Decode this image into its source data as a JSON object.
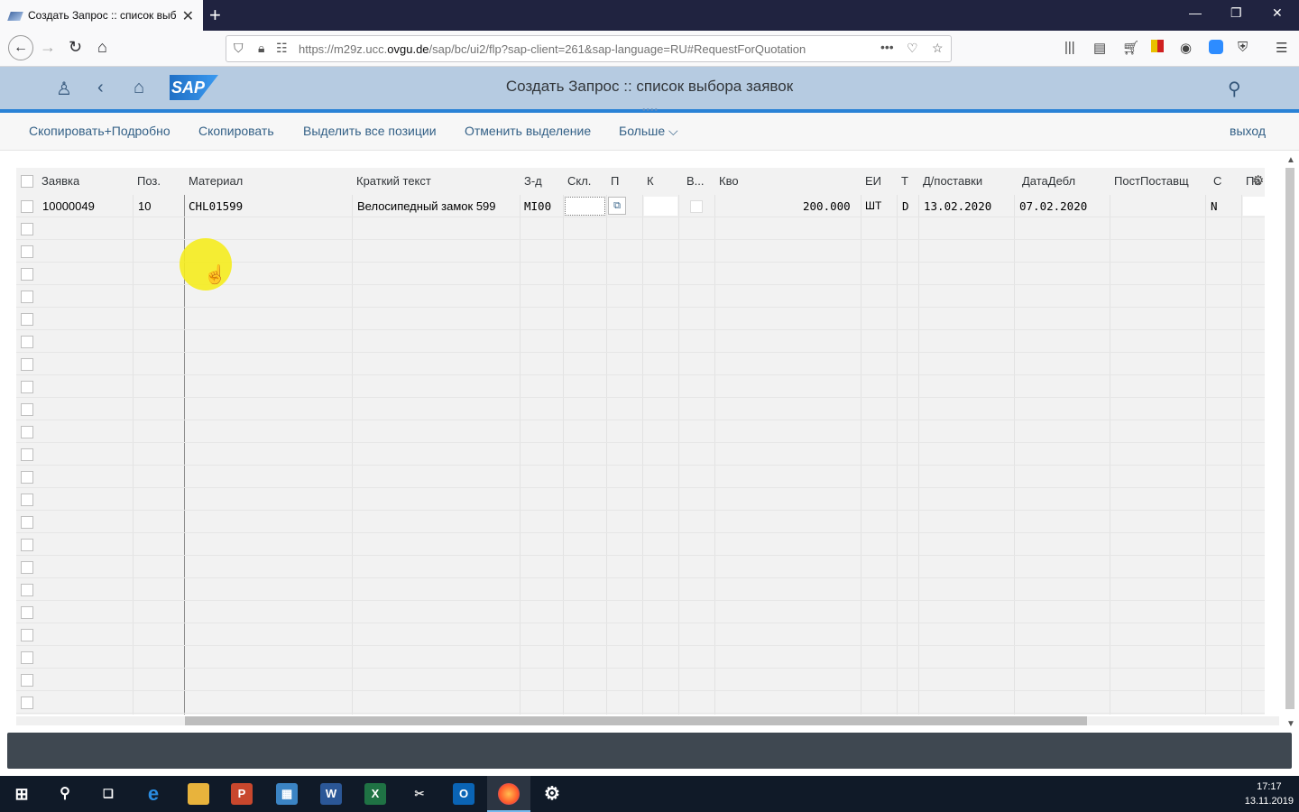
{
  "browser": {
    "tab_title": "Создать Запрос :: список выб",
    "tab_close": "✕",
    "new_tab": "+",
    "url_prefix": "https://m29z.ucc.",
    "url_domain": "ovgu.de",
    "url_rest": "/sap/bc/ui2/flp?sap-client=261&sap-language=RU#RequestForQuotation",
    "url_more": "•••"
  },
  "shell": {
    "logo_text": "SAP",
    "title": "Создать Запрос :: список выбора заявок"
  },
  "toolbar": {
    "copy_detail": "Скопировать+Подробно",
    "copy": "Скопировать",
    "select_all": "Выделить все позиции",
    "deselect": "Отменить выделение",
    "more": "Больше",
    "exit": "выход"
  },
  "grid": {
    "columns": [
      "Заявка",
      "Поз.",
      "Материал",
      "Краткий текст",
      "З-д",
      "Скл.",
      "П",
      "К",
      "В...",
      "Кво",
      "ЕИ",
      "Т",
      "Д/поставки",
      "ДатаДебл",
      "ПостПоставщ",
      "С",
      "Пар"
    ],
    "row1": {
      "request": "10000049",
      "position": "10",
      "material": "CHL01599",
      "short_text": "Велосипедный замок 599",
      "plant": "MI00",
      "storage": "",
      "quantity": "200.000",
      "unit": "ШТ",
      "type": "D",
      "delivery_date": "13.02.2020",
      "release_date": "07.02.2020",
      "supplier": "",
      "status": "N"
    }
  },
  "taskbar": {
    "time": "17:17",
    "date": "13.11.2019"
  }
}
